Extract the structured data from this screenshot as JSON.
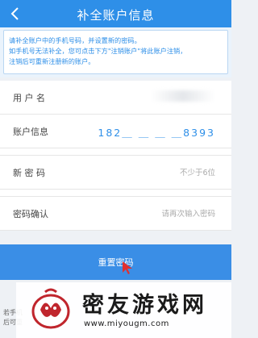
{
  "header": {
    "title": "补全账户信息",
    "back_icon": "chevron-left-icon",
    "background": "#2e8fe8"
  },
  "notice": {
    "lines": [
      "请补全账户中的手机号码，并设置新的密码。",
      "如手机号无法补全，您可点击下方\"注销账户\"将此账户注销，",
      "注销后可重新注册新的账户。"
    ]
  },
  "form": {
    "username_label": "用 户 名",
    "account_label": "账户信息",
    "account_value": "182＿ ＿ ＿ ＿8393",
    "new_password_label": "新 密 码",
    "new_password_placeholder": "不少于6位",
    "confirm_label": "密码确认",
    "confirm_placeholder": "请再次输入密码"
  },
  "submit": {
    "label": "重置密码",
    "color": "#3a8ee6"
  },
  "footer_note": {
    "lines": [
      "若手机",
      "后可重"
    ]
  },
  "watermark": {
    "title": "密友游戏网",
    "url": "www.miyougm.com"
  }
}
